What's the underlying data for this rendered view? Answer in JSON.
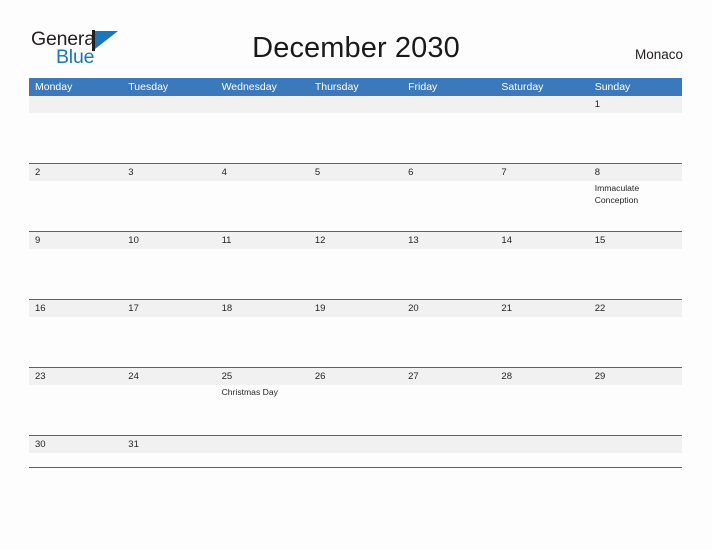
{
  "header": {
    "logo": {
      "text_top": "General",
      "text_bottom": "Blue",
      "flag_icon": "flag-triangle-icon",
      "brand_color": "#1b76bc"
    },
    "title": "December 2030",
    "country": "Monaco"
  },
  "calendar": {
    "header_color": "#3b78bc",
    "daynum_band_color": "#f1f1f1",
    "rule_color": "#2d6ca8",
    "weekdays": [
      "Monday",
      "Tuesday",
      "Wednesday",
      "Thursday",
      "Friday",
      "Saturday",
      "Sunday"
    ],
    "weeks": [
      {
        "short": false,
        "days": [
          {
            "num": "",
            "event": ""
          },
          {
            "num": "",
            "event": ""
          },
          {
            "num": "",
            "event": ""
          },
          {
            "num": "",
            "event": ""
          },
          {
            "num": "",
            "event": ""
          },
          {
            "num": "",
            "event": ""
          },
          {
            "num": "1",
            "event": ""
          }
        ]
      },
      {
        "short": false,
        "days": [
          {
            "num": "2",
            "event": ""
          },
          {
            "num": "3",
            "event": ""
          },
          {
            "num": "4",
            "event": ""
          },
          {
            "num": "5",
            "event": ""
          },
          {
            "num": "6",
            "event": ""
          },
          {
            "num": "7",
            "event": ""
          },
          {
            "num": "8",
            "event": "Immaculate Conception"
          }
        ]
      },
      {
        "short": false,
        "days": [
          {
            "num": "9",
            "event": ""
          },
          {
            "num": "10",
            "event": ""
          },
          {
            "num": "11",
            "event": ""
          },
          {
            "num": "12",
            "event": ""
          },
          {
            "num": "13",
            "event": ""
          },
          {
            "num": "14",
            "event": ""
          },
          {
            "num": "15",
            "event": ""
          }
        ]
      },
      {
        "short": false,
        "days": [
          {
            "num": "16",
            "event": ""
          },
          {
            "num": "17",
            "event": ""
          },
          {
            "num": "18",
            "event": ""
          },
          {
            "num": "19",
            "event": ""
          },
          {
            "num": "20",
            "event": ""
          },
          {
            "num": "21",
            "event": ""
          },
          {
            "num": "22",
            "event": ""
          }
        ]
      },
      {
        "short": false,
        "days": [
          {
            "num": "23",
            "event": ""
          },
          {
            "num": "24",
            "event": ""
          },
          {
            "num": "25",
            "event": "Christmas Day"
          },
          {
            "num": "26",
            "event": ""
          },
          {
            "num": "27",
            "event": ""
          },
          {
            "num": "28",
            "event": ""
          },
          {
            "num": "29",
            "event": ""
          }
        ]
      },
      {
        "short": true,
        "days": [
          {
            "num": "30",
            "event": ""
          },
          {
            "num": "31",
            "event": ""
          },
          {
            "num": "",
            "event": ""
          },
          {
            "num": "",
            "event": ""
          },
          {
            "num": "",
            "event": ""
          },
          {
            "num": "",
            "event": ""
          },
          {
            "num": "",
            "event": ""
          }
        ]
      }
    ]
  }
}
